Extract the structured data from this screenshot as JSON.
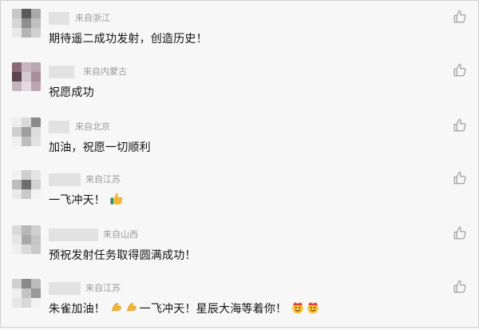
{
  "comments": [
    {
      "source": "来自浙江",
      "text": "期待遥二成功发射，创造历史！"
    },
    {
      "source": "来自内蒙古",
      "text": "祝愿成功"
    },
    {
      "source": "来自北京",
      "text": "加油，祝愿一切顺利"
    },
    {
      "source": "来自江苏",
      "text": "一飞冲天！"
    },
    {
      "source": "来自山西",
      "text": "预祝发射任务取得圆满成功！"
    },
    {
      "source": "来自江苏",
      "text_a": "朱雀加油！",
      "text_b": "一飞冲天！星辰大海等着你！"
    }
  ],
  "icons": {
    "like": "thumbs-up-outline-icon",
    "thumbs_emoji": "thumbs-up-emoji",
    "bicep_emoji": "flexed-biceps-emoji",
    "face_emoji": "face-emoji"
  },
  "colors": {
    "background": "#f7f7f7",
    "meta_text": "#9a9a9a",
    "comment_text": "#111111",
    "like_stroke": "#a0a0a0"
  }
}
